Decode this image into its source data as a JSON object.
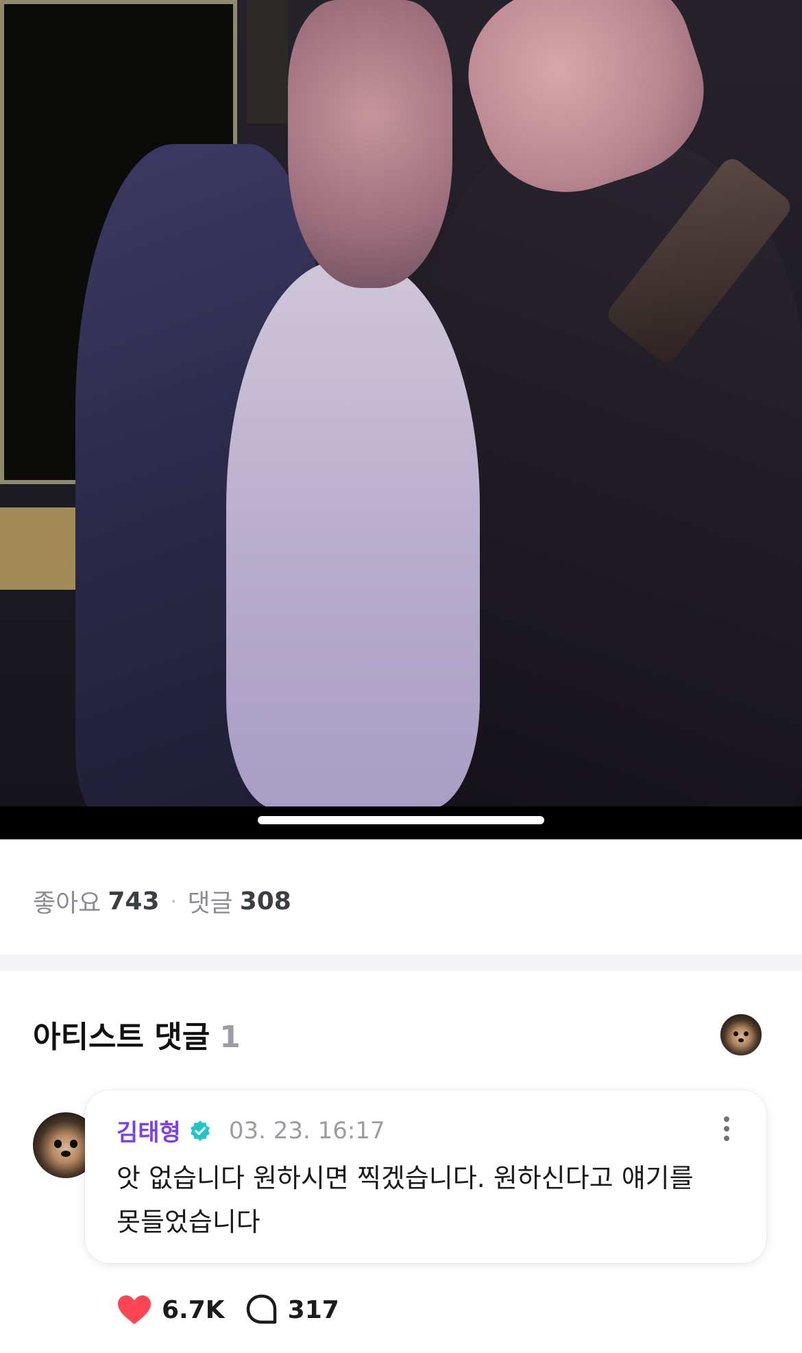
{
  "post": {
    "stats": {
      "likes_label": "좋아요",
      "likes_count": "743",
      "separator": "·",
      "comments_label": "댓글",
      "comments_count": "308"
    }
  },
  "artist_comments": {
    "title": "아티스트 댓글",
    "count": "1",
    "comment": {
      "author": "김태형",
      "verified": true,
      "timestamp": "03. 23. 16:17",
      "text": "앗 없습니다 원하시면 찍겠습니다. 원하신다고 얘기를 못들었습니다",
      "likes": "6.7K",
      "replies": "317"
    }
  },
  "colors": {
    "author_purple": "#7a3ff2",
    "verified_teal": "#1ec6c9",
    "like_red": "#ff4654"
  },
  "icons": [
    "heart-icon",
    "comment-bubble-icon",
    "verified-badge-icon",
    "more-vertical-icon"
  ]
}
